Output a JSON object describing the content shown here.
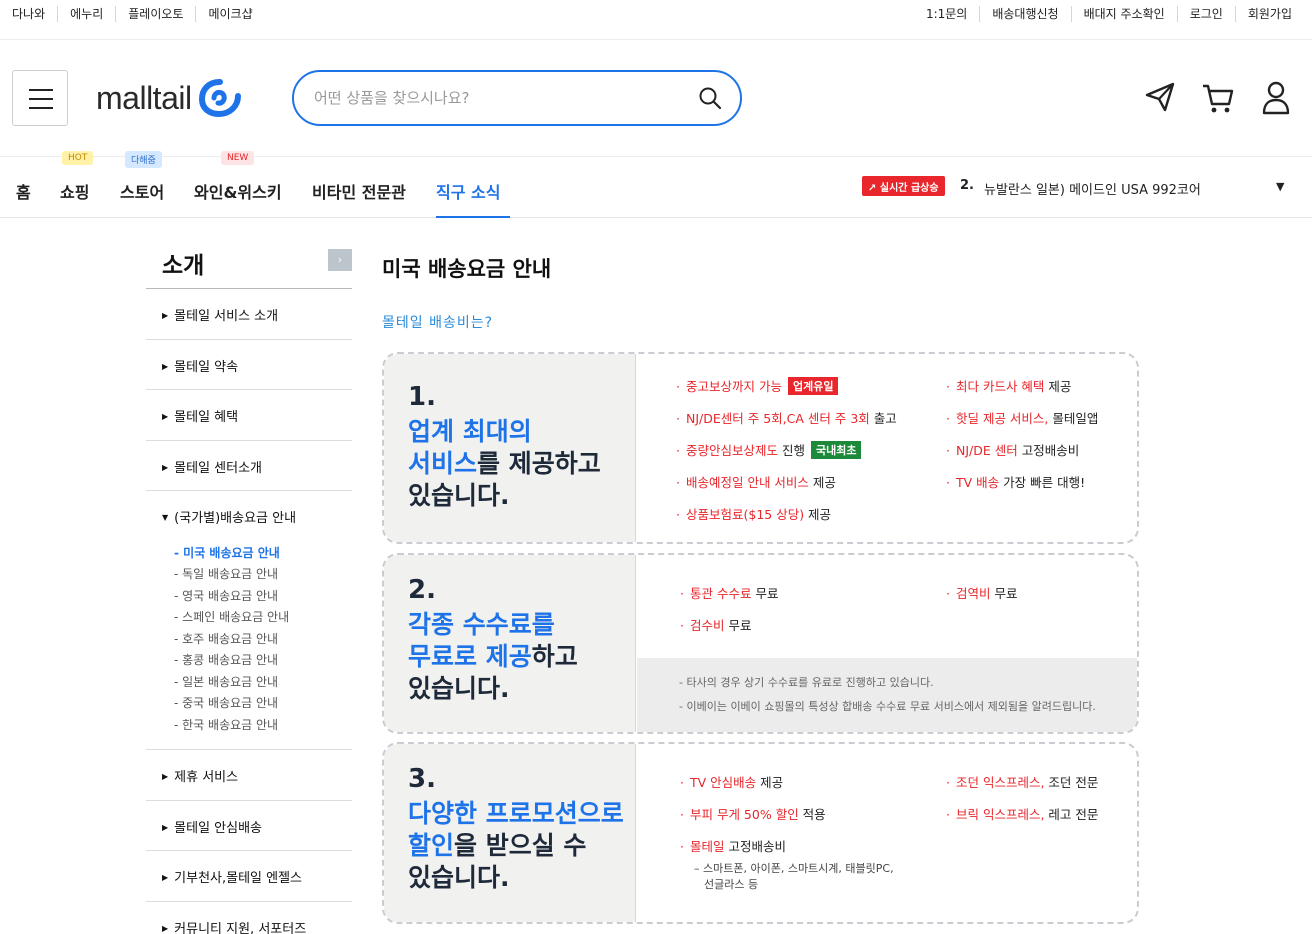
{
  "topbar": {
    "left_links": [
      "다나와",
      "에누리",
      "플레이오토",
      "메이크샵"
    ],
    "right_links": [
      "1:1문의",
      "배송대행신청",
      "배대지 주소확인",
      "로그인",
      "회원가입"
    ]
  },
  "header": {
    "logo_text": "malltail",
    "search_placeholder": "어떤 상품을 찾으시나요?",
    "icons": [
      "paper-plane-icon",
      "cart-icon",
      "user-icon"
    ]
  },
  "nav": {
    "items": [
      {
        "label": "홈"
      },
      {
        "label": "쇼핑",
        "badge": "HOT"
      },
      {
        "label": "스토어",
        "badge": "다해줌"
      },
      {
        "label": "와인&위스키",
        "badge": "NEW"
      },
      {
        "label": "비타민 전문관"
      },
      {
        "label": "직구 소식",
        "active": true
      }
    ],
    "ranking": {
      "badge": "실시간 급상승",
      "number": "2.",
      "text": "뉴발란스 일본) 메이드인 USA 992코어"
    }
  },
  "sidebar": {
    "title": "소개",
    "toggle": "›",
    "items": [
      {
        "label": "몰테일 서비스 소개"
      },
      {
        "label": "몰테일 약속"
      },
      {
        "label": "몰테일 혜택"
      },
      {
        "label": "몰테일 센터소개"
      },
      {
        "label": "(국가별)배송요금 안내",
        "open": true
      },
      {
        "label": "제휴 서비스"
      },
      {
        "label": "몰테일 안심배송"
      },
      {
        "label": "기부천사,몰테일 엔젤스"
      },
      {
        "label": "커뮤니티 지원, 서포터즈"
      }
    ],
    "sub_items": [
      {
        "label": "- 미국 배송요금 안내",
        "active": true
      },
      {
        "label": "- 독일 배송요금 안내"
      },
      {
        "label": "- 영국 배송요금 안내"
      },
      {
        "label": "- 스페인 배송요금 안내"
      },
      {
        "label": "- 호주 배송요금 안내"
      },
      {
        "label": "- 홍콩 배송요금 안내"
      },
      {
        "label": "- 일본 배송요금 안내"
      },
      {
        "label": "- 중국 배송요금 안내"
      },
      {
        "label": "- 한국 배송요금 안내"
      }
    ]
  },
  "content": {
    "title": "미국 배송요금 안내",
    "subtitle": "몰테일 배송비는?",
    "cards": [
      {
        "number": "1.",
        "line1_blue": "업계 최대의",
        "line2_blue": "서비스",
        "line2_rest": "를 제공하고",
        "line3": "있습니다.",
        "features": [
          {
            "red": "중고보상까지 가능",
            "rest": "",
            "tag": "업계유일",
            "tag_color": "red"
          },
          {
            "red": "NJ/DE센터 주 5회,CA 센터 주 3회",
            "rest": " 출고"
          },
          {
            "red": "중량안심보상제도",
            "rest": " 진행",
            "tag": "국내최초",
            "tag_color": "green"
          },
          {
            "red": "배송예정일 안내 서비스",
            "rest": " 제공"
          },
          {
            "red": "상품보험료($15 상당)",
            "rest": " 제공"
          },
          {
            "red": "최다 카드사 혜택",
            "rest": " 제공"
          },
          {
            "red": "핫딜 제공 서비스,",
            "rest": " 몰테일앱"
          },
          {
            "red": "NJ/DE 센터",
            "rest": " 고정배송비"
          },
          {
            "red": "TV 배송",
            "rest": " 가장 빠른 대행!"
          }
        ]
      },
      {
        "number": "2.",
        "line1_blue": "각종 수수료를",
        "line2_blue": "무료로 제공",
        "line2_rest": "하고",
        "line3": "있습니다.",
        "features": [
          {
            "red": "통관 수수료",
            "rest": " 무료"
          },
          {
            "red": "검수비",
            "rest": " 무료"
          },
          {
            "red": "검역비",
            "rest": " 무료"
          }
        ],
        "notes": [
          "- 타사의 경우 상기 수수료를 유료로 진행하고 있습니다.",
          "- 이베이는 이베이 쇼핑몰의 특성상 합배송 수수료 무료 서비스에서 제외됨을 알려드립니다."
        ]
      },
      {
        "number": "3.",
        "line1_blue": "다양한 프로모션으로",
        "line2_blue": "할인",
        "line2_rest": "을 받으실 수",
        "line3": "있습니다.",
        "features": [
          {
            "red": "TV 안심배송",
            "rest": " 제공"
          },
          {
            "red": "부피 무게 50% 할인",
            "rest": " 적용"
          },
          {
            "red": "몰테일",
            "rest": " 고정배송비"
          },
          {
            "red": "조던 익스프레스,",
            "rest": " 조던 전문"
          },
          {
            "red": "브릭 익스프레스,",
            "rest": " 레고 전문"
          }
        ],
        "subnote_lines": [
          "– 스마트폰, 아이폰, 스마트시계, 태블릿PC,",
          "선글라스 등"
        ]
      }
    ]
  },
  "colors": {
    "accent": "#1e73e8",
    "red": "#e8262b",
    "green": "#1d8a3a"
  }
}
